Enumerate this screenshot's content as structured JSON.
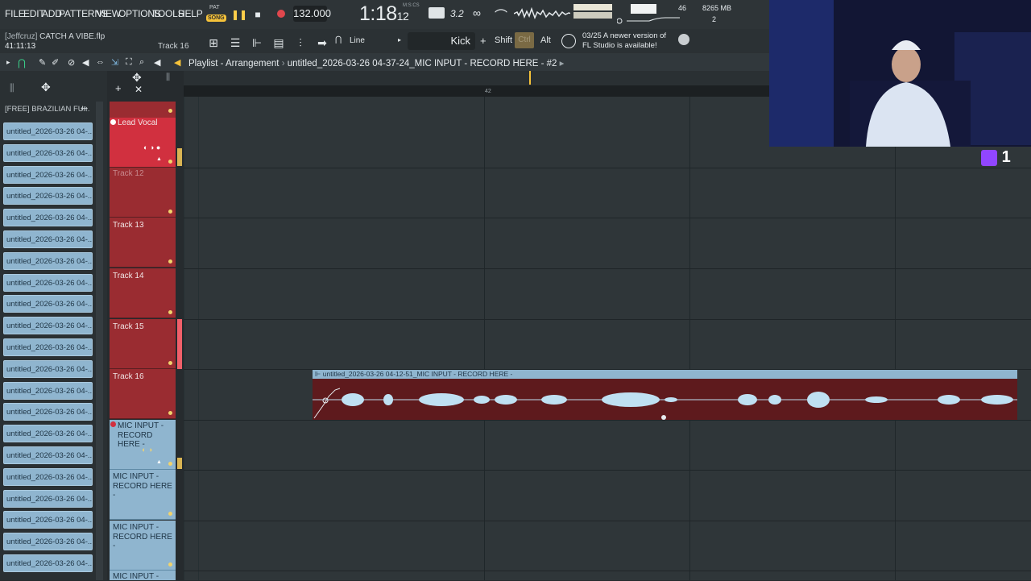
{
  "menu": {
    "items": [
      "FILE",
      "EDIT",
      "ADD",
      "PATTERNS",
      "VIEW",
      "OPTIONS",
      "TOOLS",
      "HELP"
    ],
    "pat_label": "PAT",
    "song_label": "SONG"
  },
  "transport": {
    "tempo": "132.000",
    "time_main": "1:18",
    "time_sub": "12",
    "time_label": "M:S:CS",
    "step_label": "3.2",
    "cpu": "46",
    "memory": "8265 MB",
    "polyphony": "2"
  },
  "project": {
    "user": "[Jeffcruz]",
    "name": "CATCH A VIBE.flp",
    "clock": "41:11:13",
    "track_hint": "Track 16"
  },
  "toolbar2": {
    "snap": "Line",
    "channel": "Kick",
    "plus": "+",
    "shift": "Shift",
    "ctrl": "Ctrl",
    "alt": "Alt",
    "notice_date": "03/25",
    "notice_line1": "A newer version of",
    "notice_line2": "FL Studio is available!"
  },
  "playlist": {
    "title": "Playlist - Arrangement",
    "arrangement": "untitled_2026-03-26 04-37-24_MIC INPUT - RECORD HERE - #2",
    "ruler_marker": "42"
  },
  "browser": {
    "title": "[FREE] BRAZILIAN FU...",
    "items": [
      "untitled_2026-03-26 04-...",
      "untitled_2026-03-26 04-...",
      "untitled_2026-03-26 04-...",
      "untitled_2026-03-26 04-...",
      "untitled_2026-03-26 04-...",
      "untitled_2026-03-26 04-...",
      "untitled_2026-03-26 04-...",
      "untitled_2026-03-26 04-...",
      "untitled_2026-03-26 04-...",
      "untitled_2026-03-26 04-...",
      "untitled_2026-03-26 04-...",
      "untitled_2026-03-26 04-...",
      "untitled_2026-03-26 04-...",
      "untitled_2026-03-26 04-...",
      "untitled_2026-03-26 04-...",
      "untitled_2026-03-26 04-...",
      "untitled_2026-03-26 04-...",
      "untitled_2026-03-26 04-...",
      "untitled_2026-03-26 04-...",
      "untitled_2026-03-26 04-...",
      "untitled_2026-03-26 04-..."
    ]
  },
  "tracks": {
    "t11": "Lead Vocal",
    "t12": "Track 12",
    "t13": "Track 13",
    "t14": "Track 14",
    "t15": "Track 15",
    "t16": "Track 16",
    "t17a": "MIC INPUT -",
    "t17b": "RECORD HERE -",
    "t18a": "MIC INPUT -",
    "t18b": "RECORD HERE -",
    "t19a": "MIC INPUT -",
    "t19b": "RECORD HERE -",
    "t20": "MIC INPUT -"
  },
  "clip": {
    "label": "untitled_2026-03-26 04-12-51_MIC INPUT - RECORD HERE -"
  },
  "stream": {
    "viewer_count": "1"
  },
  "colors": {
    "accent": "#f5c23a",
    "track_red": "#9a2c31",
    "track_blue": "#8fb5cf",
    "twitch": "#9146ff"
  }
}
